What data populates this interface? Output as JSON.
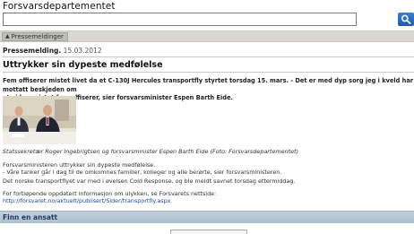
{
  "site": {
    "title": "Forsvarsdepartementet"
  },
  "search": {
    "value": "",
    "placeholder": ""
  },
  "nav": {
    "tab_label": "Pressemeldinger"
  },
  "article": {
    "type_label": "Pressemelding.",
    "date": "15.03.2012",
    "title": "Uttrykker sin dypeste medfølelse",
    "lead_line1": "Fem offiserer mistet livet da et C-130J Hercules transportfly styrtet torsdag 15. mars. - Det er med dyp sorg jeg i kveld har mottatt beskjeden om",
    "lead_line2": "at vi har mistet fem offiserer, sier forsvarsminister Espen Barth Eide.",
    "photo_caption": "Statssekretær Roger Ingebrigtsen og forsvarsminister Espen Barth Eide (Foto: Forsvarsdepartementet)",
    "p1_line1": "Forsvarsministeren uttrykker sin dypeste medfølelse.",
    "p1_line2": "- Våre tanker går i dag til de omkomnes familier, kolleger og alle berørte, sier forsvarsministeren.",
    "p2": "Det norske transportflyet var med i øvelsen Cold Response, og ble meldt savnet torsdag ettermiddag.",
    "p3_line1": "For fortløpende oppdatert informasjon om ulykken, se Forsvarets nettside:",
    "p3_link": "http://forsvaret.no/aktuelt/publisert/Sider/transportfly.aspx"
  },
  "sidebar": {
    "find_employee_label": "Finn en ansatt"
  },
  "icons": {
    "search": "search-icon",
    "nav_arrow": "triangle-up-icon"
  },
  "colors": {
    "search_button": "#2a68bb",
    "nav_bar": "#d9d9d1",
    "find_bar": "#b8c8d7",
    "link": "#1a4ea0"
  }
}
